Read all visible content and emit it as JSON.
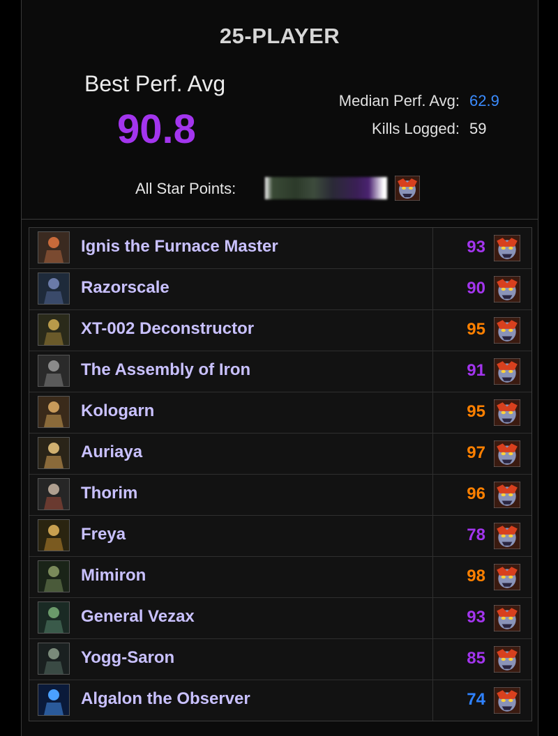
{
  "header": {
    "title": "25-PLAYER",
    "best_perf_label": "Best Perf. Avg",
    "best_perf_value": "90.8",
    "median_label": "Median Perf. Avg:",
    "median_value": "62.9",
    "kills_label": "Kills Logged:",
    "kills_value": "59",
    "star_points_label": "All Star Points:"
  },
  "colors": {
    "purple": "#a335ee",
    "orange": "#ff8000",
    "blue": "#2f82ff",
    "boss_name": "#c9c1ff"
  },
  "bosses": [
    {
      "name": "Ignis the Furnace Master",
      "score": "93",
      "tier": "purple",
      "icon": "ignis-portrait-icon"
    },
    {
      "name": "Razorscale",
      "score": "90",
      "tier": "purple",
      "icon": "razorscale-portrait-icon"
    },
    {
      "name": "XT-002 Deconstructor",
      "score": "95",
      "tier": "orange",
      "icon": "xt002-portrait-icon"
    },
    {
      "name": "The Assembly of Iron",
      "score": "91",
      "tier": "purple",
      "icon": "assembly-portrait-icon"
    },
    {
      "name": "Kologarn",
      "score": "95",
      "tier": "orange",
      "icon": "kologarn-portrait-icon"
    },
    {
      "name": "Auriaya",
      "score": "97",
      "tier": "orange",
      "icon": "auriaya-portrait-icon"
    },
    {
      "name": "Thorim",
      "score": "96",
      "tier": "orange",
      "icon": "thorim-portrait-icon"
    },
    {
      "name": "Freya",
      "score": "78",
      "tier": "purple",
      "icon": "freya-portrait-icon"
    },
    {
      "name": "Mimiron",
      "score": "98",
      "tier": "orange",
      "icon": "mimiron-portrait-icon"
    },
    {
      "name": "General Vezax",
      "score": "93",
      "tier": "purple",
      "icon": "vezax-portrait-icon"
    },
    {
      "name": "Yogg-Saron",
      "score": "85",
      "tier": "purple",
      "icon": "yogg-saron-portrait-icon"
    },
    {
      "name": "Algalon the Observer",
      "score": "74",
      "tier": "blue",
      "icon": "algalon-portrait-icon"
    }
  ]
}
